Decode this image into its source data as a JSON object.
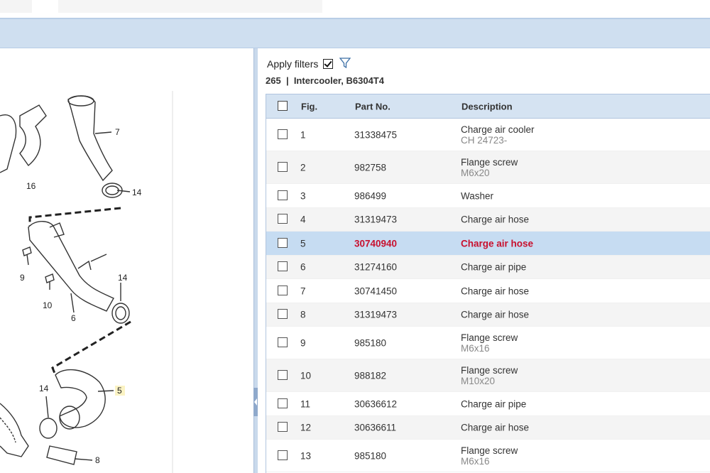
{
  "filters": {
    "apply_label": "Apply filters",
    "checked": true,
    "icon": "filter-icon"
  },
  "group": {
    "number": "265",
    "separator": "|",
    "name": "Intercooler, B6304T4"
  },
  "table": {
    "headers": {
      "fig": "Fig.",
      "part_no": "Part No.",
      "description": "Description"
    },
    "rows": [
      {
        "fig": "1",
        "part_no": "31338475",
        "description": "Charge air cooler",
        "note": "CH 24723-"
      },
      {
        "fig": "2",
        "part_no": "982758",
        "description": "Flange screw",
        "note": "M6x20"
      },
      {
        "fig": "3",
        "part_no": "986499",
        "description": "Washer",
        "note": ""
      },
      {
        "fig": "4",
        "part_no": "31319473",
        "description": "Charge air hose",
        "note": ""
      },
      {
        "fig": "5",
        "part_no": "30740940",
        "description": "Charge air hose",
        "note": "",
        "selected": true
      },
      {
        "fig": "6",
        "part_no": "31274160",
        "description": "Charge air pipe",
        "note": ""
      },
      {
        "fig": "7",
        "part_no": "30741450",
        "description": "Charge air hose",
        "note": ""
      },
      {
        "fig": "8",
        "part_no": "31319473",
        "description": "Charge air hose",
        "note": ""
      },
      {
        "fig": "9",
        "part_no": "985180",
        "description": "Flange screw",
        "note": "M6x16"
      },
      {
        "fig": "10",
        "part_no": "988182",
        "description": "Flange screw",
        "note": "M10x20"
      },
      {
        "fig": "11",
        "part_no": "30636612",
        "description": "Charge air pipe",
        "note": ""
      },
      {
        "fig": "12",
        "part_no": "30636611",
        "description": "Charge air hose",
        "note": ""
      },
      {
        "fig": "13",
        "part_no": "985180",
        "description": "Flange screw",
        "note": "M6x16"
      }
    ]
  },
  "diagram": {
    "callouts": [
      "16",
      "7",
      "14",
      "9",
      "10",
      "6",
      "14",
      "14",
      "5",
      "8"
    ],
    "highlight_callout": "5"
  },
  "colors": {
    "selected_row": "#c6dcf2",
    "selected_text": "#c8102e",
    "header": "#d5e3f2",
    "band": "#cfdff0"
  }
}
